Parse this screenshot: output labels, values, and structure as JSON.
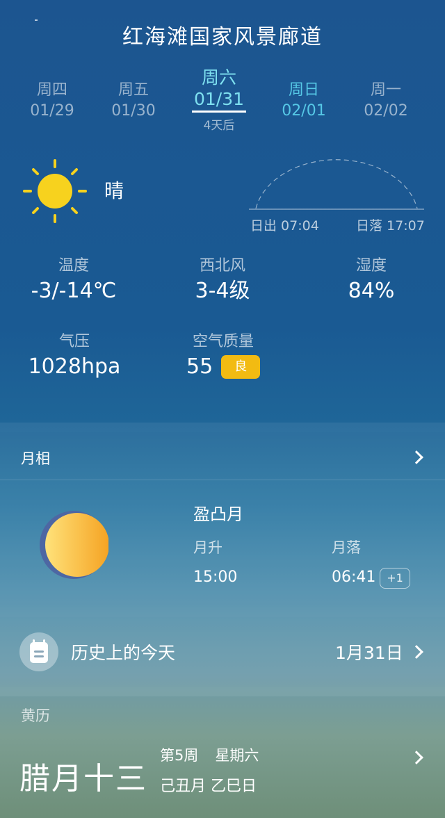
{
  "header": {
    "title": "红海滩国家风景廊道"
  },
  "days": [
    {
      "weekday": "周四",
      "date": "01/29"
    },
    {
      "weekday": "周五",
      "date": "01/30"
    },
    {
      "weekday": "周六",
      "date": "01/31",
      "sub": "4天后"
    },
    {
      "weekday": "周日",
      "date": "02/01"
    },
    {
      "weekday": "周一",
      "date": "02/02"
    }
  ],
  "current": {
    "condition": "晴",
    "condition_icon": "sun-icon",
    "sunrise": "日出 07:04",
    "sunset": "日落 17:07",
    "temp_label": "温度",
    "temp_value": "-3/-14℃",
    "wind_label": "西北风",
    "wind_value": "3-4级",
    "humidity_label": "湿度",
    "humidity_value": "84%",
    "pressure_label": "气压",
    "pressure_value": "1028hpa",
    "aqi_label": "空气质量",
    "aqi_value": "55",
    "aqi_badge": "良",
    "aqi_color": "#f2bb12"
  },
  "moon": {
    "section_title": "月相",
    "phase": "盈凸月",
    "rise_label": "月升",
    "rise_value": "15:00",
    "set_label": "月落",
    "set_value": "06:41",
    "set_offset": "+1"
  },
  "history": {
    "title": "历史上的今天",
    "date": "1月31日"
  },
  "huangli": {
    "section_title": "黄历",
    "lunar_day": "腊月十三",
    "week": "第5周",
    "weekday": "星期六",
    "ganzhi": "己丑月 乙巳日"
  }
}
